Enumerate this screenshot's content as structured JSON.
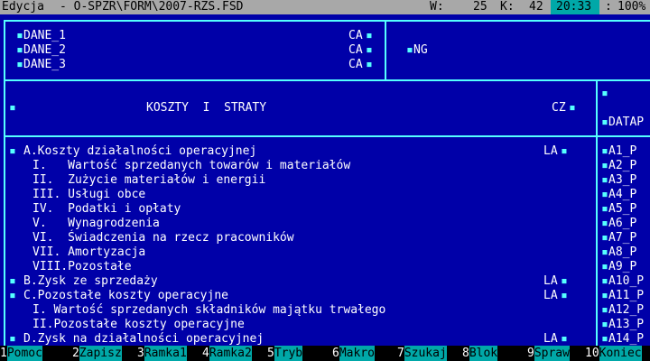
{
  "titlebar": {
    "edit_label": "Edycja",
    "file_path": "- O-SPZR\\FORM\\2007-RZS.FSD",
    "w_label": "W:",
    "w_value": "25",
    "k_label": "K:",
    "k_value": "42",
    "time": "20:33",
    "zoom": "100%"
  },
  "header_fields": [
    {
      "name": "DANE_1",
      "type": "CA"
    },
    {
      "name": "DANE_2",
      "type": "CA"
    },
    {
      "name": "DANE_3",
      "type": "CA"
    }
  ],
  "ng_field": "NG",
  "section_header": {
    "title": "KOSZTY  I  STRATY",
    "type": "CZ"
  },
  "datap_label": "DATAP",
  "rows": [
    {
      "text": "A.Koszty działalności operacyjnej",
      "type": "LA",
      "code": "A1_P"
    },
    {
      "text": "I.   Wartość sprzedanych towarów i materiałów",
      "type": "",
      "code": "A2_P"
    },
    {
      "text": "II.  Zużycie materiałów i energii",
      "type": "",
      "code": "A3_P"
    },
    {
      "text": "III. Usługi obce",
      "type": "",
      "code": "A4_P"
    },
    {
      "text": "IV.  Podatki i opłaty",
      "type": "",
      "code": "A5_P"
    },
    {
      "text": "V.   Wynagrodzenia",
      "type": "",
      "code": "A6_P"
    },
    {
      "text": "VI.  Świadczenia na rzecz pracowników",
      "type": "",
      "code": "A7_P"
    },
    {
      "text": "VII. Amortyzacja",
      "type": "",
      "code": "A8_P"
    },
    {
      "text": "VIII.Pozostałe",
      "type": "",
      "code": "A9_P"
    },
    {
      "text": "B.Zysk ze sprzedaży",
      "type": "LA",
      "code": "A10_P"
    },
    {
      "text": "C.Pozostałe koszty operacyjne",
      "type": "LA",
      "code": "A11_P"
    },
    {
      "text": "I. Wartość sprzedanych składników majątku trwałego",
      "type": "",
      "code": "A12_P"
    },
    {
      "text": "II.Pozostałe koszty operacyjne",
      "type": "",
      "code": "A13_P"
    },
    {
      "text": "D.Zysk na działalności operacyjnej",
      "type": "LA",
      "code": "A14_P"
    }
  ],
  "fkeys": [
    {
      "num": "1",
      "label": "Pomoc"
    },
    {
      "num": "2",
      "label": "Zapisz"
    },
    {
      "num": "3",
      "label": "Ramka1"
    },
    {
      "num": "4",
      "label": "Ramka2"
    },
    {
      "num": "5",
      "label": "Tryb"
    },
    {
      "num": "6",
      "label": "Makro"
    },
    {
      "num": "7",
      "label": "Szukaj"
    },
    {
      "num": "8",
      "label": "Blok"
    },
    {
      "num": "9",
      "label": "Spraw"
    },
    {
      "num": "10",
      "label": "Koniec"
    }
  ]
}
